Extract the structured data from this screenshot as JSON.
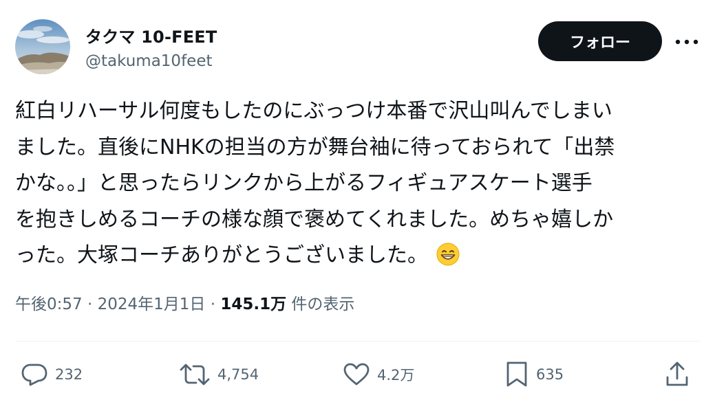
{
  "user": {
    "display_name": "タクマ 10-FEET",
    "handle": "@takuma10feet"
  },
  "header": {
    "follow_label": "フォロー",
    "more_icon": "more-horizontal-icon"
  },
  "tweet": {
    "lines": [
      "紅白リハーサル何度もしたのにぶっつけ本番で沢山叫んでしまい",
      "ました。直後にNHKの担当の方が舞台袖に待っておられて「出禁",
      "かな。。」と思ったらリンクから上がるフィギュアスケート選手",
      "を抱きしめるコーチの様な顔で褒めてくれました。めちゃ嬉しか",
      "った。大塚コーチありがとうございました。"
    ],
    "emoji": "grinning-face-with-smiling-eyes"
  },
  "meta": {
    "time": "午後0:57",
    "sep1": " · ",
    "date": "2024年1月1日",
    "sep2": " · ",
    "views_count": "145.1万",
    "views_label": " 件の表示"
  },
  "actions": {
    "replies": "232",
    "retweets": "4,754",
    "likes": "4.2万",
    "bookmarks": "635"
  },
  "colors": {
    "text_primary": "#0f1419",
    "text_secondary": "#536471",
    "follow_bg": "#0f1419",
    "divider": "#eff3f4"
  }
}
